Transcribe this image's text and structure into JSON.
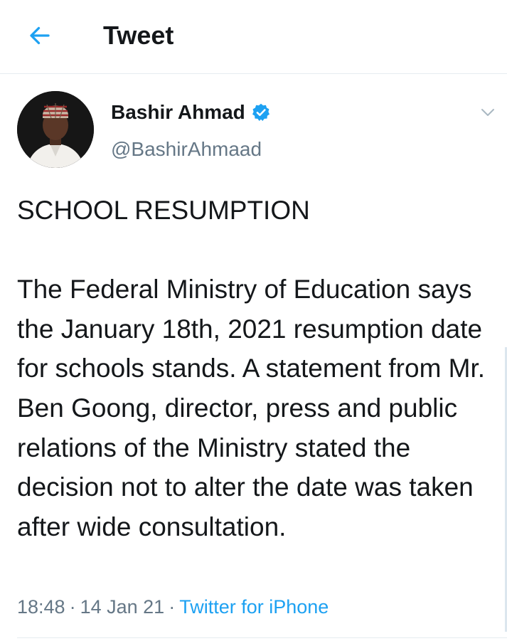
{
  "header": {
    "title": "Tweet",
    "back_icon": "arrow-left-icon",
    "accent_color": "#1da1f2"
  },
  "tweet": {
    "author": {
      "name": "Bashir Ahmad",
      "handle": "@BashirAhmaad",
      "verified_icon": "verified-badge-icon"
    },
    "text": "SCHOOL RESUMPTION\n\nThe Federal Ministry of Education says the January 18th, 2021 resumption date for schools stands. A statement from Mr. Ben Goong, director, press and public relations of the Ministry stated the decision not to alter the date was taken after wide consultation.",
    "time": "18:48",
    "separator": "·",
    "date": "14 Jan 21",
    "source": "Twitter for iPhone"
  }
}
